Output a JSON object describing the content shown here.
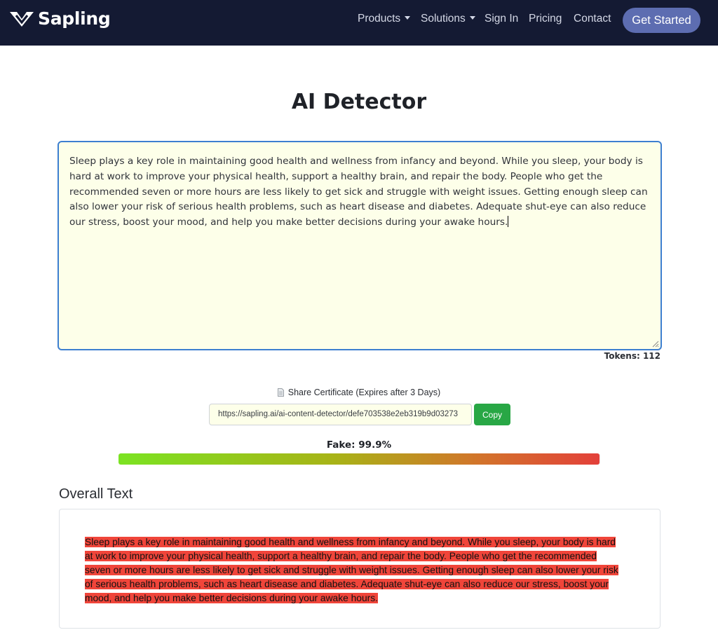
{
  "navbar": {
    "brand": "Sapling",
    "links": [
      {
        "label": "Products",
        "dropdown": true
      },
      {
        "label": "Solutions",
        "dropdown": true
      },
      {
        "label": "Sign In",
        "dropdown": false
      },
      {
        "label": "Pricing",
        "dropdown": false
      },
      {
        "label": "Contact",
        "dropdown": false
      }
    ],
    "cta_label": "Get Started"
  },
  "page": {
    "title": "AI Detector"
  },
  "editor": {
    "text": "Sleep plays a key role in maintaining good health and wellness from infancy and beyond. While you sleep, your body is hard at work to improve your physical health, support a healthy brain, and repair the body. People who get the recommended seven or more hours are less likely to get sick and struggle with weight issues. Getting enough sleep can also lower your risk of serious health problems, such as heart disease and diabetes. Adequate shut-eye can also reduce our stress, boost your mood, and help you make better decisions during your awake hours.",
    "tokens_label": "Tokens: 112"
  },
  "share": {
    "label": "Share Certificate (Expires after 3 Days)",
    "url": "https://sapling.ai/ai-content-detector/defe703538e2eb319b9d03273",
    "copy_label": "Copy"
  },
  "score": {
    "label": "Fake: 99.9%",
    "fraction": 0.999
  },
  "overall": {
    "heading": "Overall Text",
    "highlighted_text": "Sleep plays a key role in maintaining good health and wellness from infancy and beyond. While you sleep, your body is hard at work to improve your physical health, support a healthy brain, and repair the body. People who get the recommended seven or more hours are less likely to get sick and struggle with weight issues. Getting enough sleep can also lower your risk of serious health problems, such as heart disease and diabetes. Adequate shut-eye can also reduce our stress, boost your mood, and help you make better decisions during your awake hours."
  },
  "colors": {
    "navbar_bg": "#141a33",
    "cta_bg": "#5d6db1",
    "editor_bg": "#fdffe9",
    "editor_border": "#3d7fd0",
    "copy_bg": "#28a745",
    "highlight": "#f0453a"
  },
  "icons": {
    "logo": "sapling-check-logo",
    "share": "document-icon",
    "resize": "resize-grip-icon"
  }
}
